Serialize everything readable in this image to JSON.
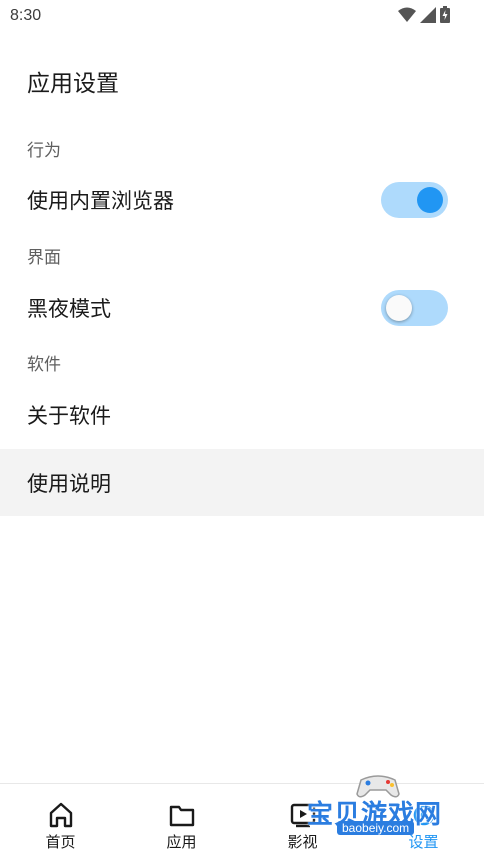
{
  "status_bar": {
    "time": "8:30"
  },
  "header": {
    "title": "应用设置"
  },
  "sections": {
    "behavior": {
      "title": "行为",
      "item_label": "使用内置浏览器",
      "toggle_on": true
    },
    "interface": {
      "title": "界面",
      "item_label": "黑夜模式",
      "toggle_on": false
    },
    "software": {
      "title": "软件",
      "items": [
        {
          "label": "关于软件"
        },
        {
          "label": "使用说明"
        }
      ]
    }
  },
  "bottom_nav": {
    "items": [
      {
        "label": "首页",
        "icon": "home-icon"
      },
      {
        "label": "应用",
        "icon": "folder-icon"
      },
      {
        "label": "影视",
        "icon": "video-icon"
      },
      {
        "label": "设置",
        "icon": "settings-icon"
      }
    ],
    "active_index": 3
  },
  "watermark": {
    "text": "宝贝游戏网",
    "url": "baobeiy.com"
  },
  "colors": {
    "accent": "#2196f3",
    "toggle_track": "#aedafc",
    "highlight_row": "#f3f3f3"
  }
}
